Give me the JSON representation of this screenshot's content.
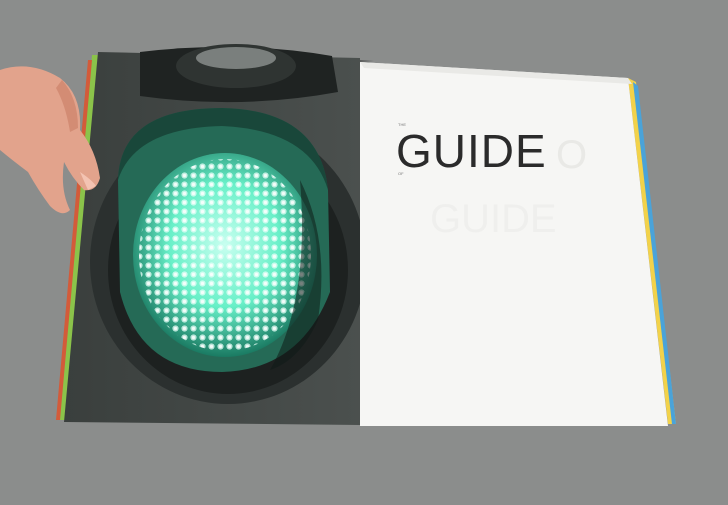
{
  "book": {
    "heading": "GUIDE",
    "small_text_above": "THE",
    "small_text_below": "OF"
  },
  "palette": {
    "background": "#8b8d8c",
    "page_white": "#f6f6f4",
    "signal_green": "#5ff0c8",
    "housing_dark": "#2b302f",
    "edge_green": "#8bc34a",
    "edge_yellow": "#f2d24a"
  }
}
